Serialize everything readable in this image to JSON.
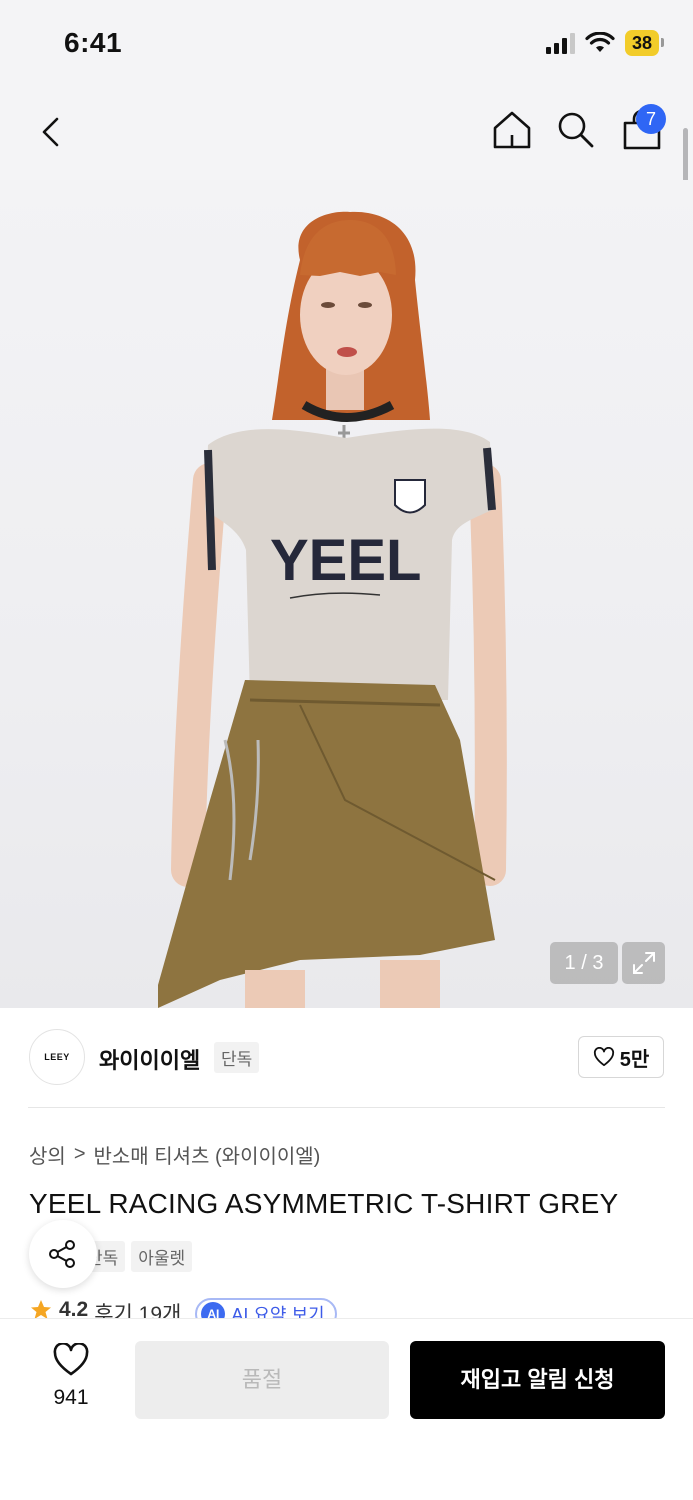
{
  "status_bar": {
    "time": "6:41",
    "battery": "38"
  },
  "nav": {
    "cart_count": "7"
  },
  "gallery": {
    "page_indicator": "1 / 3"
  },
  "brand": {
    "logo_text": "LEEY",
    "name": "와이이이엘",
    "tag": "단독",
    "likes": "5만"
  },
  "breadcrumb": {
    "category": "상의",
    "separator": ">",
    "subcategory": "반소매 티셔츠 (와이이이엘)"
  },
  "product": {
    "title": "YEEL RACING ASYMMETRIC T-SHIRT GREY",
    "tags": [
      "단독",
      "아울렛"
    ],
    "rating": "4.2",
    "reviews": "후기 19개",
    "ai_label": "AI",
    "ai_summary": "AI 요약 보기"
  },
  "bottom": {
    "wish_count": "941",
    "soldout_label": "품절",
    "restock_label": "재입고 알림 신청"
  },
  "colors": {
    "accent": "#2f66f5",
    "battery": "#f2cc2a",
    "primary_button": "#000000",
    "star": "#f5a623"
  }
}
